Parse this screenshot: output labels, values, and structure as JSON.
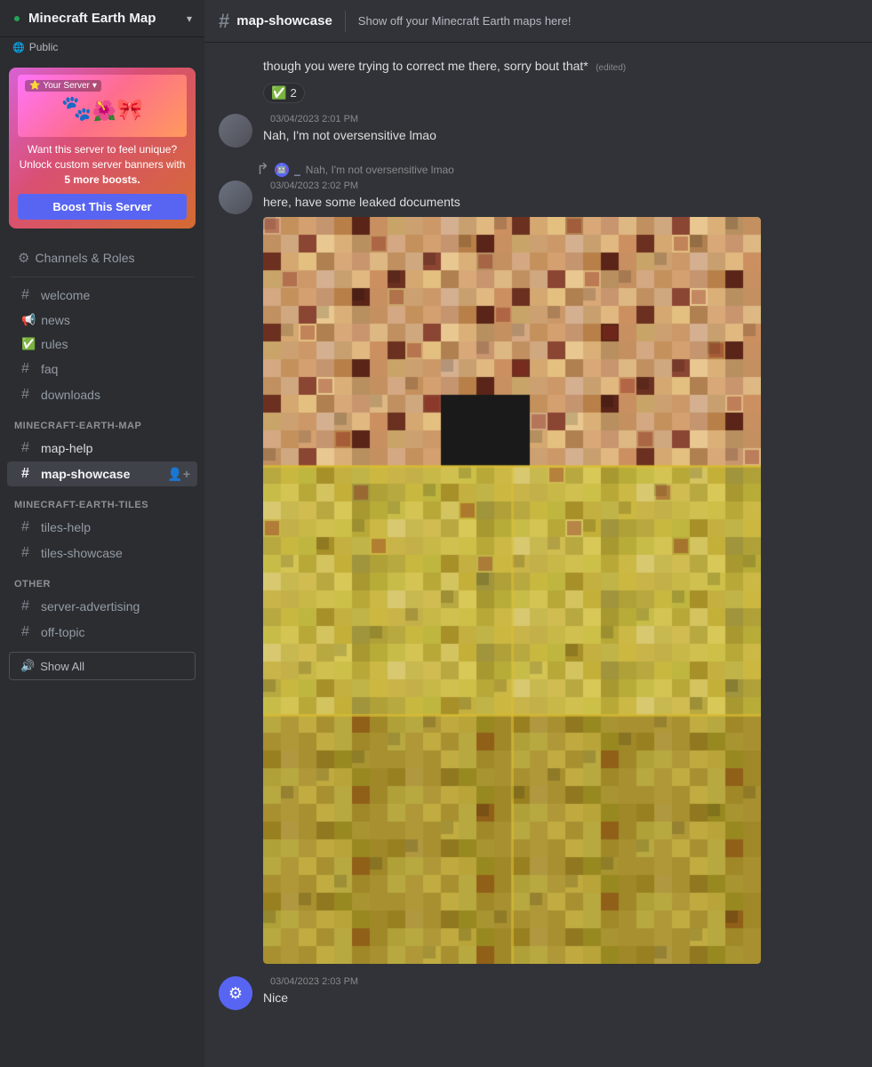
{
  "server": {
    "name": "Minecraft Earth Map",
    "tag": "Public",
    "boost_banner_label": "Your Server",
    "boost_banner_text": "Want this server to feel unique? Unlock custom server banners with ",
    "boost_banner_bold": "5 more boosts.",
    "boost_button": "Boost This Server"
  },
  "sidebar": {
    "channels_roles": "Channels & Roles",
    "sections": [
      {
        "name": "",
        "channels": [
          {
            "icon": "#",
            "name": "welcome",
            "type": "text"
          },
          {
            "icon": "📢",
            "name": "news",
            "type": "announce"
          },
          {
            "icon": "✅",
            "name": "rules",
            "type": "rules"
          },
          {
            "icon": "#",
            "name": "faq",
            "type": "text"
          },
          {
            "icon": "#",
            "name": "downloads",
            "type": "text"
          }
        ]
      },
      {
        "name": "MINECRAFT-EARTH-MAP",
        "channels": [
          {
            "icon": "#",
            "name": "map-help",
            "type": "text"
          },
          {
            "icon": "#",
            "name": "map-showcase",
            "type": "text",
            "active": true
          }
        ]
      },
      {
        "name": "MINECRAFT-EARTH-TILES",
        "channels": [
          {
            "icon": "#",
            "name": "tiles-help",
            "type": "text"
          },
          {
            "icon": "#",
            "name": "tiles-showcase",
            "type": "text"
          }
        ]
      },
      {
        "name": "OTHER",
        "channels": [
          {
            "icon": "#",
            "name": "server-advertising",
            "type": "text"
          },
          {
            "icon": "#",
            "name": "off-topic",
            "type": "text"
          }
        ]
      }
    ],
    "show_all": "Show All"
  },
  "topbar": {
    "hash": "#",
    "channel": "map-showcase",
    "description": "Show off your Minecraft Earth maps here!"
  },
  "messages": [
    {
      "id": "msg1",
      "type": "continuation",
      "text": "though you were trying to correct me there, sorry bout that*",
      "edited": "(edited)",
      "reaction": {
        "emoji": "✅",
        "count": "2"
      }
    },
    {
      "id": "msg2",
      "type": "full",
      "avatar_color": "#4e5058",
      "username": "",
      "timestamp": "03/04/2023 2:01 PM",
      "text": "Nah, I'm not oversensitive lmao"
    },
    {
      "id": "msg3",
      "type": "full_with_reply",
      "reply_username": "_",
      "reply_text": "Nah, I'm not oversensitive lmao",
      "avatar_color": "#4e5058",
      "username": "",
      "timestamp": "03/04/2023 2:02 PM",
      "text": "here, have some leaked documents",
      "has_image": true
    },
    {
      "id": "msg4",
      "type": "full",
      "avatar_color": "#5865f2",
      "avatar_icon": "discord",
      "username": "",
      "timestamp": "03/04/2023 2:03 PM",
      "text": "Nice"
    }
  ]
}
